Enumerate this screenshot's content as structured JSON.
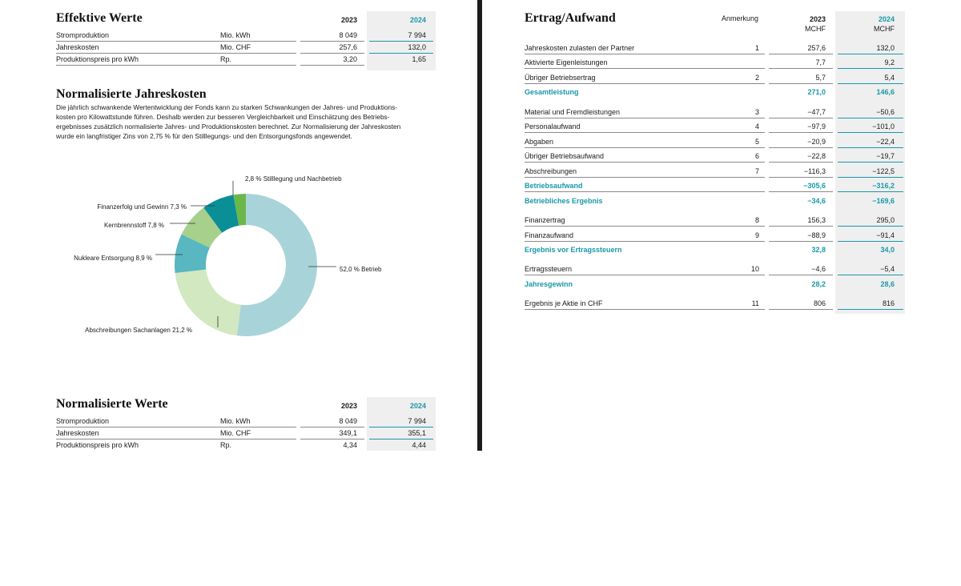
{
  "effektive": {
    "title": "Effektive Werte",
    "col_2023": "2023",
    "col_2024": "2024",
    "rows": [
      {
        "label": "Stromproduktion",
        "unit": "Mio. kWh",
        "v2023": "8 049",
        "v2024": "7 994"
      },
      {
        "label": "Jahreskosten",
        "unit": "Mio. CHF",
        "v2023": "257,6",
        "v2024": "132,0"
      },
      {
        "label": "Produktionspreis pro kWh",
        "unit": "Rp.",
        "v2023": "3,20",
        "v2024": "1,65"
      }
    ]
  },
  "normalisierte_jahreskosten": {
    "title": "Normalisierte Jahreskosten",
    "paragraph_lines": [
      "Die jährlich schwankende Wertentwicklung der Fonds kann zu starken Schwankungen der Jahres- und Produktions-",
      "kosten pro Kilowattstunde führen. Deshalb werden zur besseren Vergleichbarkeit und Einschätzung des Betriebs-",
      "ergebnisses zusätzlich normalisierte Jahres- und Produktionskosten berechnet. Zur Normalisierung der Jahreskosten",
      "wurde ein langfristiger Zins von 2,75 % für den Stilllegungs- und den Entsorgungsfonds angewendet."
    ]
  },
  "chart_data": {
    "type": "pie",
    "variant": "donut",
    "slices": [
      {
        "name": "Betrieb",
        "value": 52.0,
        "label": "52,0 %",
        "color": "#a8d4d9"
      },
      {
        "name": "Abschreibungen Sachanlagen",
        "value": 21.2,
        "label": "21,2 %",
        "color": "#d2e8c0"
      },
      {
        "name": "Nukleare Entsorgung",
        "value": 8.9,
        "label": "8,9 %",
        "color": "#58b7c1"
      },
      {
        "name": "Kernbrennstoff",
        "value": 7.8,
        "label": "7,8 %",
        "color": "#a6d08c"
      },
      {
        "name": "Finanzerfolg und Gewinn",
        "value": 7.3,
        "label": "7,3 %",
        "color": "#0b8f97"
      },
      {
        "name": "Stilllegung und Nachbetrieb",
        "value": 2.8,
        "label": "2,8 %",
        "color": "#6cb74a"
      }
    ]
  },
  "normalisierte": {
    "title": "Normalisierte Werte",
    "col_2023": "2023",
    "col_2024": "2024",
    "rows": [
      {
        "label": "Stromproduktion",
        "unit": "Mio. kWh",
        "v2023": "8 049",
        "v2024": "7 994"
      },
      {
        "label": "Jahreskosten",
        "unit": "Mio. CHF",
        "v2023": "349,1",
        "v2024": "355,1"
      },
      {
        "label": "Produktionspreis pro kWh",
        "unit": "Rp.",
        "v2023": "4,34",
        "v2024": "4,44"
      }
    ]
  },
  "ertrag": {
    "title": "Ertrag/Aufwand",
    "col_note": "Anmerkung",
    "col_2023": "2023",
    "col_2024": "2024",
    "unit_2023": "MCHF",
    "unit_2024": "MCHF",
    "rows": [
      {
        "label": "Jahreskosten zulasten der Partner",
        "note": "1",
        "v2023": "257,6",
        "v2024": "132,0"
      },
      {
        "label": "Aktivierte Eigenleistungen",
        "note": "",
        "v2023": "7,7",
        "v2024": "9,2"
      },
      {
        "label": "Übriger Betriebsertrag",
        "note": "2",
        "v2023": "5,7",
        "v2024": "5,4"
      },
      {
        "label": "Gesamtleistung",
        "note": "",
        "v2023": "271,0",
        "v2024": "146,6",
        "total": true
      },
      {
        "label": "Material und Fremdleistungen",
        "note": "3",
        "v2023": "−47,7",
        "v2024": "−50,6"
      },
      {
        "label": "Personalaufwand",
        "note": "4",
        "v2023": "−97,9",
        "v2024": "−101,0"
      },
      {
        "label": "Abgaben",
        "note": "5",
        "v2023": "−20,9",
        "v2024": "−22,4"
      },
      {
        "label": "Übriger Betriebsaufwand",
        "note": "6",
        "v2023": "−22,8",
        "v2024": "−19,7"
      },
      {
        "label": "Abschreibungen",
        "note": "7",
        "v2023": "−116,3",
        "v2024": "−122,5"
      },
      {
        "label": "Betriebsaufwand",
        "note": "",
        "v2023": "−305,6",
        "v2024": "−316,2",
        "total": true
      },
      {
        "label": "Betriebliches Ergebnis",
        "note": "",
        "v2023": "−34,6",
        "v2024": "−169,6",
        "total": true
      },
      {
        "label": "Finanzertrag",
        "note": "8",
        "v2023": "156,3",
        "v2024": "295,0"
      },
      {
        "label": "Finanzaufwand",
        "note": "9",
        "v2023": "−88,9",
        "v2024": "−91,4"
      },
      {
        "label": "Ergebnis vor Ertragssteuern",
        "note": "",
        "v2023": "32,8",
        "v2024": "34,0",
        "total": true
      },
      {
        "label": "Ertragssteuern",
        "note": "10",
        "v2023": "−4,6",
        "v2024": "−5,4"
      },
      {
        "label": "Jahresgewinn",
        "note": "",
        "v2023": "28,2",
        "v2024": "28,6",
        "total": true
      },
      {
        "label": "Ergebnis je Aktie in CHF",
        "note": "11",
        "v2023": "806",
        "v2024": "816"
      }
    ]
  }
}
